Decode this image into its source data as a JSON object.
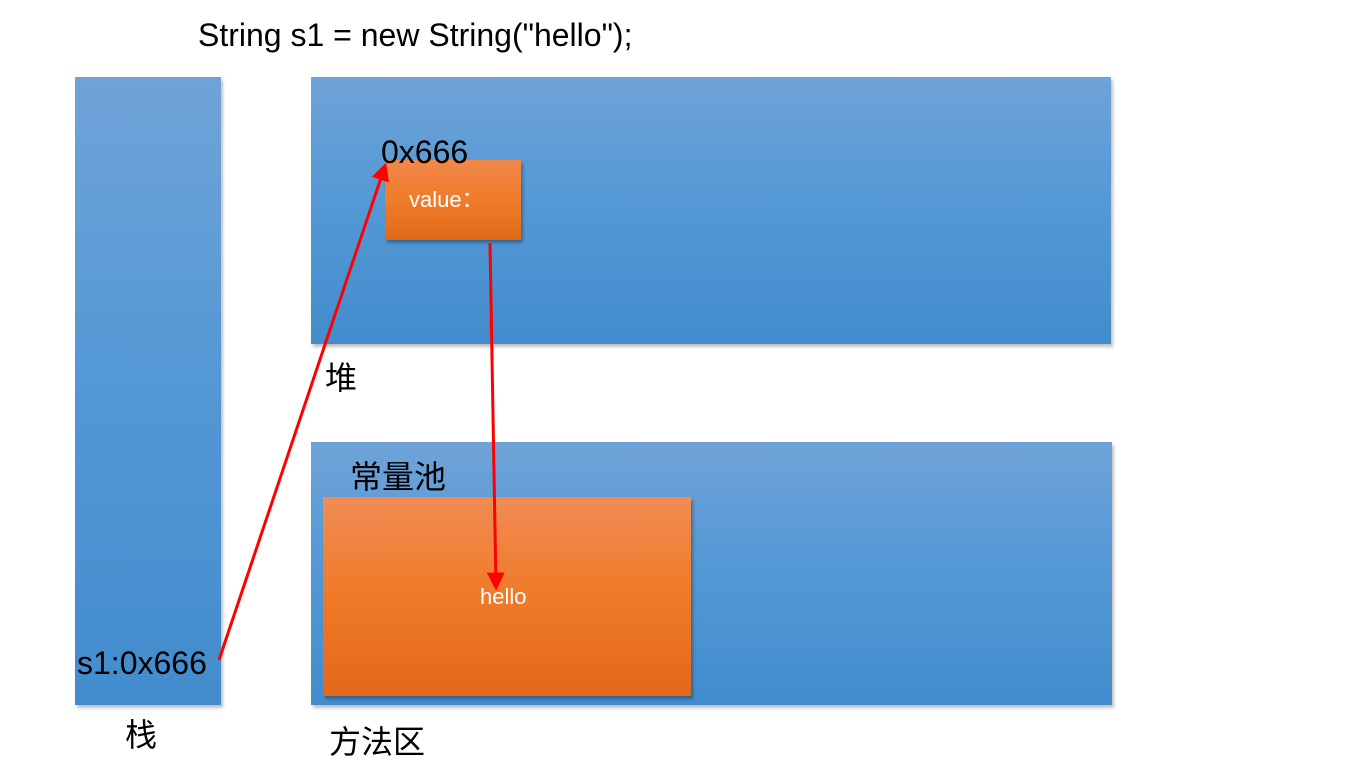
{
  "title": "String s1 = new String(\"hello\");",
  "stack": {
    "name": "栈",
    "variable": "s1:0x666"
  },
  "heap": {
    "name": "堆",
    "object_address": "0x666",
    "object_field": "value："
  },
  "method_area": {
    "name": "方法区",
    "pool_name": "常量池",
    "pool_value": "hello"
  },
  "colors": {
    "region_blue": "#5599d6",
    "object_orange": "#f07c2a",
    "arrow_red": "#ff0000"
  }
}
